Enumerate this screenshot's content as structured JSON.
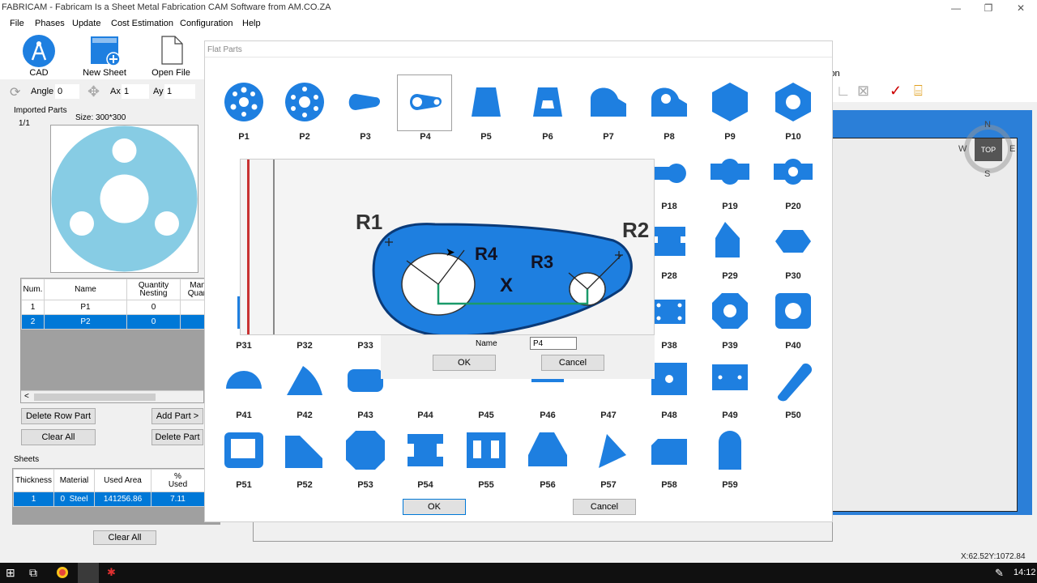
{
  "window": {
    "title": "FABRICAM - Fabricam Is a Sheet Metal Fabrication CAM Software from AM.CO.ZA",
    "minimize": "—",
    "maximize": "❐",
    "close": "✕"
  },
  "menu": [
    "File",
    "Phases",
    "Update",
    "Cost Estimation",
    "Configuration",
    "Help"
  ],
  "toolbar": {
    "cad": "CAD",
    "new_sheet": "New Sheet",
    "open_file": "Open File",
    "angle_label": "Angle",
    "angle_value": "0",
    "ax_label": "Ax",
    "ax_value": "1",
    "ay_label": "Ay",
    "ay_value": "1",
    "right_fragment": "ion"
  },
  "imported": {
    "title": "Imported Parts",
    "page": "1/1",
    "size": "Size: 300*300",
    "columns": [
      "Num.",
      "Name",
      "Quantity\nNesting",
      "Man\nQuan"
    ],
    "rows": [
      {
        "num": "1",
        "name": "P1",
        "qty": "0"
      },
      {
        "num": "2",
        "name": "P2",
        "qty": "0"
      }
    ],
    "scroll_left": "<",
    "delete_row": "Delete Row Part",
    "add_part": "Add Part >",
    "clear_all": "Clear All",
    "delete_part": "Delete Part"
  },
  "sheets": {
    "title": "Sheets",
    "columns": [
      "Thickness",
      "Material",
      "Used Area",
      "%\nUsed"
    ],
    "row": {
      "thickness": "1",
      "material_id": "0",
      "material": "Steel",
      "used_area": "141256.86",
      "used": "7.11"
    },
    "clear_all": "Clear All"
  },
  "flat_parts": {
    "title": "Flat Parts",
    "ok": "OK",
    "cancel": "Cancel",
    "row1": [
      "P1",
      "P2",
      "P3",
      "P4",
      "P5",
      "P6",
      "P7",
      "P8",
      "P9",
      "P10"
    ],
    "row2": [
      "P18",
      "P19",
      "P20"
    ],
    "row3": [
      "P28",
      "P29",
      "P30"
    ],
    "row4": [
      "P31",
      "P32",
      "P33",
      "P38",
      "P39",
      "P40"
    ],
    "row5": [
      "P41",
      "P42",
      "P43",
      "P44",
      "P45",
      "P46",
      "P47",
      "P48",
      "P49",
      "P50"
    ],
    "row6": [
      "P51",
      "P52",
      "P53",
      "P54",
      "P55",
      "P56",
      "P57",
      "P58",
      "P59"
    ]
  },
  "preview": {
    "r1": "R1",
    "r2": "R2",
    "r3": "R3",
    "r4": "R4",
    "x": "X",
    "name_label": "Name",
    "name_value": "P4",
    "ok": "OK",
    "cancel": "Cancel"
  },
  "compass": {
    "n": "N",
    "s": "S",
    "e": "E",
    "w": "W",
    "top": "TOP"
  },
  "status": {
    "coords": "X:62.52Y:1072.84"
  },
  "taskbar": {
    "time": "14:12"
  },
  "colors": {
    "part_blue": "#1e7fe0",
    "preview_disc": "#87cce4",
    "select_blue": "#0078d7"
  }
}
